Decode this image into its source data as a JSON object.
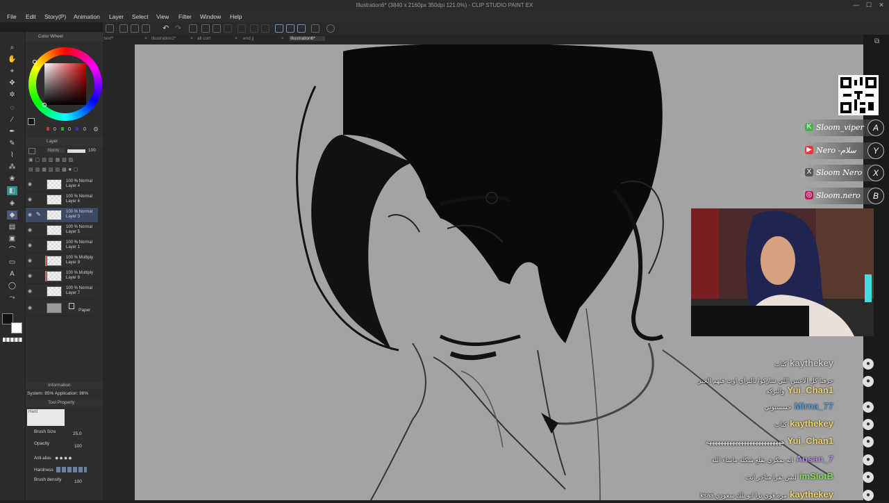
{
  "window": {
    "title": "Illustration6* (3840 x 2160px 350dpi 121.0%) - CLIP STUDIO PAINT EX"
  },
  "menu": [
    "File",
    "Edit",
    "Story(P)",
    "Animation",
    "Layer",
    "Select",
    "View",
    "Filter",
    "Window",
    "Help"
  ],
  "tabs": [
    "text*",
    "illustration2*",
    "all cort",
    "end jj",
    "Illustration6*"
  ],
  "color_panel": {
    "title": "Color Wheel",
    "values": [
      "0",
      "0",
      "0"
    ]
  },
  "layer_panel": {
    "title": "Layer",
    "blend": "Norm",
    "opacity": "100",
    "layers": [
      {
        "mode": "100 % Normal",
        "name": "Layer 4",
        "selected": false,
        "red": false
      },
      {
        "mode": "100 % Normal",
        "name": "Layer 6",
        "selected": false,
        "red": false
      },
      {
        "mode": "100 % Normal",
        "name": "Layer 3",
        "selected": true,
        "red": false
      },
      {
        "mode": "100 % Normal",
        "name": "Layer 5",
        "selected": false,
        "red": false
      },
      {
        "mode": "100 % Normal",
        "name": "Layer 1",
        "selected": false,
        "red": false
      },
      {
        "mode": "100 % Multiply",
        "name": "Layer 9",
        "selected": false,
        "red": true
      },
      {
        "mode": "100 % Multiply",
        "name": "Layer 8",
        "selected": false,
        "red": true
      },
      {
        "mode": "100 % Normal",
        "name": "Layer 7",
        "selected": false,
        "red": false
      }
    ],
    "paper": "Paper"
  },
  "info_panel": {
    "title": "Information",
    "system": "System: 85%  Application: 98%"
  },
  "tool_property": {
    "title": "Tool Property",
    "preset": "Hard",
    "brush_size": {
      "label": "Brush Size",
      "value": "25.0"
    },
    "opacity": {
      "label": "Opacity",
      "value": "100"
    },
    "antialias": {
      "label": "Anti-alias"
    },
    "hardness": {
      "label": "Hardness"
    },
    "brush_density": {
      "label": "Brush density",
      "value": "100"
    }
  },
  "stream": {
    "socials": [
      {
        "icon": "K",
        "text": "Sloom_viper",
        "badge": "A",
        "color": "#4caf50"
      },
      {
        "icon": "▶",
        "text": "Nero -سلام",
        "badge": "Y",
        "color": "#e53935"
      },
      {
        "icon": "X",
        "text": "Sloom Nero",
        "badge": "X",
        "color": "#555555"
      },
      {
        "icon": "◎",
        "text": "Sloom.nero",
        "badge": "B",
        "color": "#c2185b"
      }
    ],
    "chat": [
      {
        "msg": "كتاب",
        "user": "kaythekey",
        "color": "#c8c8c8"
      },
      {
        "msg": "حرفيا كل الاعبين اللي شاركوا بالتراي اوت فيهم الخير والبركه",
        "user": "Yui_Chan1",
        "color": "#f2d36b"
      },
      {
        "msg": "حسستوني",
        "user": "Mirna_77",
        "color": "#5b9bd5"
      },
      {
        "msg": "كتاب",
        "user": "kaythekey",
        "color": "#f2d36b"
      },
      {
        "msg": "ههههههههههههههههههههههههههه",
        "user": "Yui_Chan1",
        "color": "#f2d36b"
      },
      {
        "msg": "ايه بمكري يقلع شكله ماشاء الله",
        "user": "Ansan_7",
        "color": "#b38bd9"
      },
      {
        "msg": "ليش نقرا متاخر انت",
        "user": "imSlotB",
        "color": "#8bd96b"
      },
      {
        "msg": "ksaa مره قوي ترا انو تلك سعودي",
        "user": "kaythekey",
        "color": "#f2d36b"
      }
    ]
  }
}
